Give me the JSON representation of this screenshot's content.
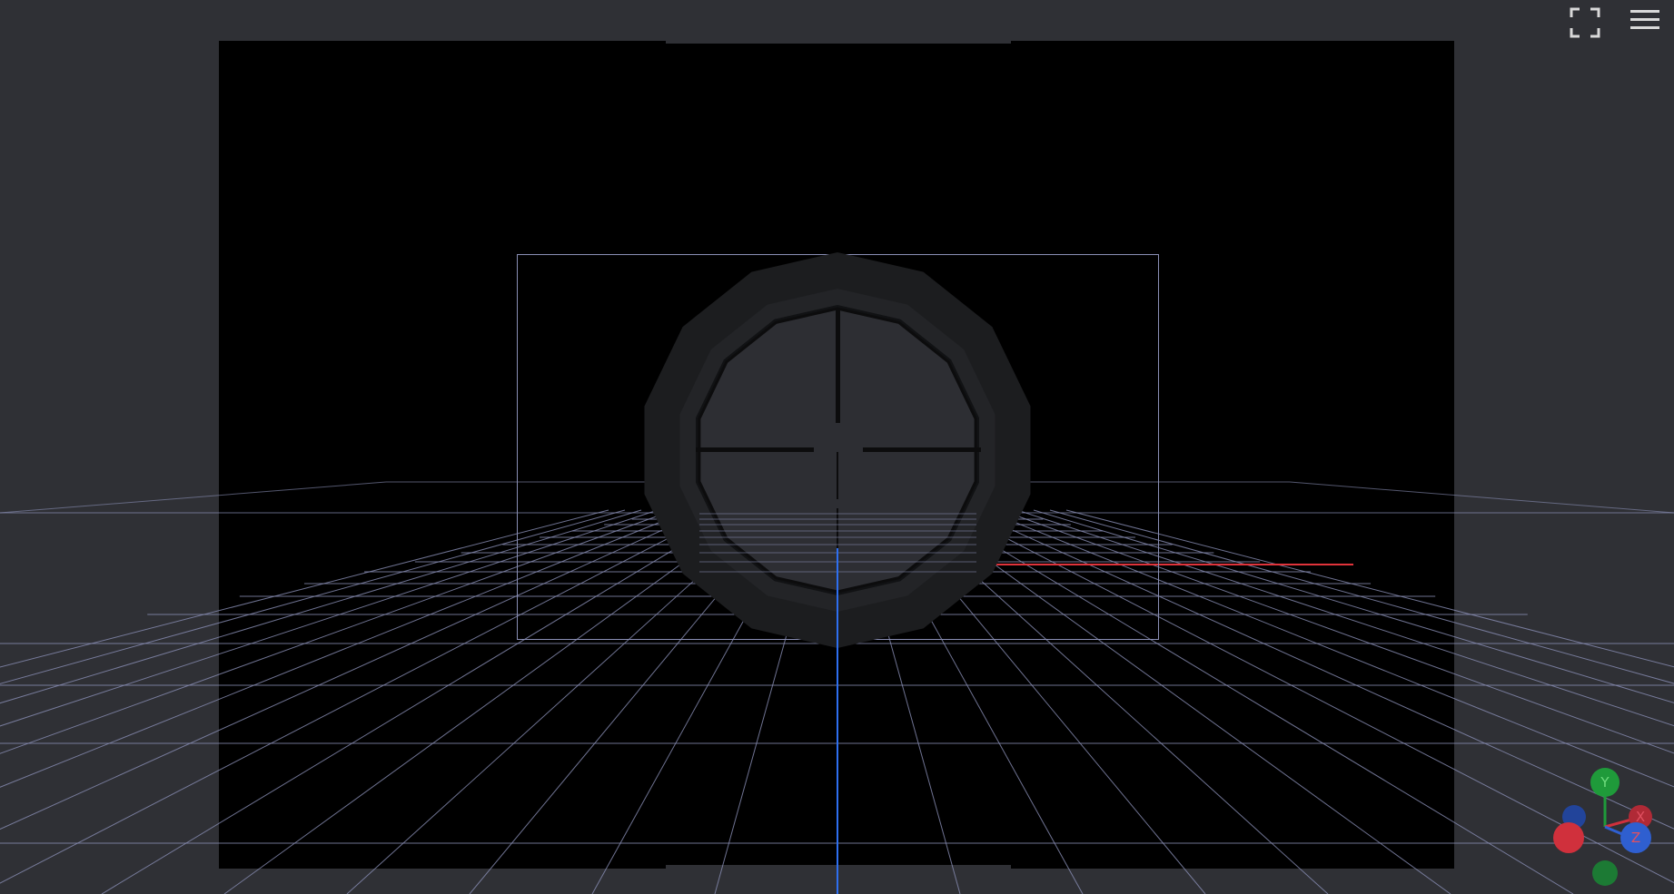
{
  "toolbar": {
    "fullscreen_icon": "fullscreen-icon",
    "menu_icon": "hamburger-menu-icon"
  },
  "colors": {
    "background": "#2f3035",
    "canvas": "#000000",
    "grid_line": "#8a8fb5",
    "x_axis": "#e0333b",
    "z_axis": "#2e6ff0",
    "scope_body": "#1c1d1f",
    "lens": "#2d2e33"
  },
  "axis_gizmo": {
    "y_label": "Y",
    "x_label": "X",
    "z_label": "Z",
    "y_color": "#1f9a3a",
    "x_color": "#d0303c",
    "z_color": "#2f5fd0",
    "neg_y_color": "#1c7a34",
    "neg_x_color": "#b02a36",
    "neg_z_color": "#22449a"
  },
  "scene": {
    "object_icon": "rifle-scope-model"
  }
}
